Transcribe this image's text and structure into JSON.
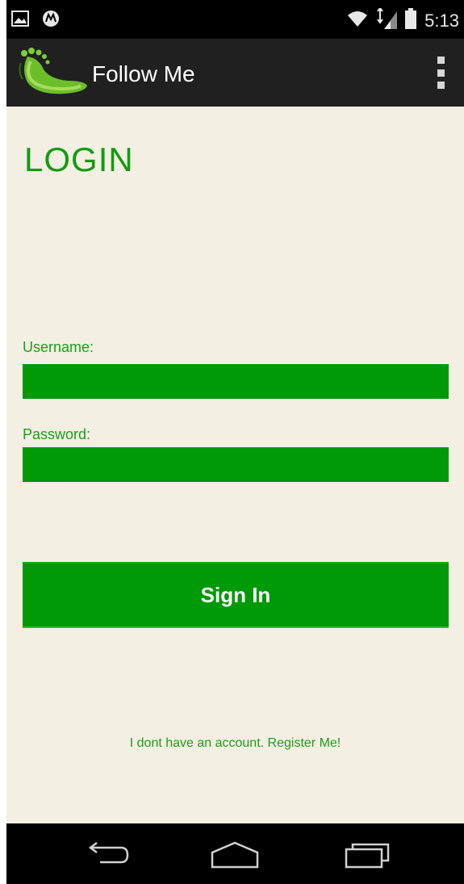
{
  "status_bar": {
    "time": "5:13",
    "icons": [
      "image-notification-icon",
      "motorola-icon",
      "wifi-icon",
      "signal-icon",
      "battery-icon"
    ]
  },
  "action_bar": {
    "title": "Follow Me",
    "logo": "footprint-logo-icon",
    "menu_icon": "overflow-menu-icon"
  },
  "login": {
    "heading": "LOGIN",
    "username_label": "Username:",
    "username_value": "",
    "password_label": "Password:",
    "password_value": "",
    "sign_in_label": "Sign In",
    "register_link": "I dont have an account. Register Me!"
  },
  "nav_bar": {
    "icons": [
      "back-icon",
      "home-icon",
      "recents-icon"
    ]
  },
  "colors": {
    "accent": "#009908",
    "text_green": "#18a018",
    "background": "#f3efe3",
    "action_bar": "#202020",
    "status_bar": "#000000"
  }
}
